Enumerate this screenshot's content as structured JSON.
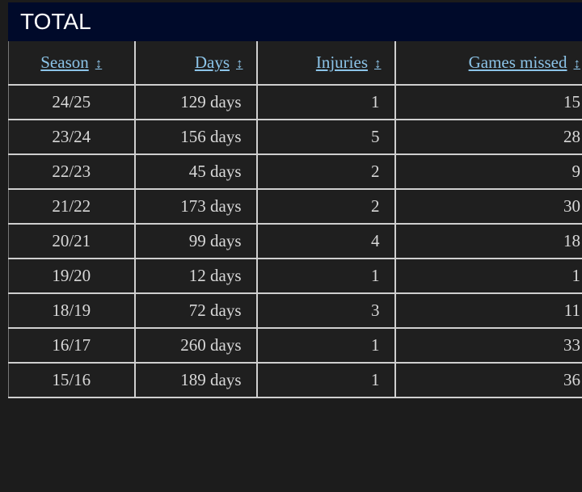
{
  "title": "TOTAL",
  "colors": {
    "header_bg": "#000a2a",
    "link": "#8cc4e8",
    "row_bg": "#1f1f1f"
  },
  "columns": [
    {
      "label": "Season",
      "sort_icon": "sort-arrows-icon"
    },
    {
      "label": "Days",
      "sort_icon": "sort-arrows-icon"
    },
    {
      "label": "Injuries",
      "sort_icon": "sort-arrows-icon"
    },
    {
      "label": "Games missed",
      "sort_icon": "sort-arrows-icon"
    }
  ],
  "rows": [
    {
      "season": "24/25",
      "days": "129 days",
      "injuries": "1",
      "games_missed": "15"
    },
    {
      "season": "23/24",
      "days": "156 days",
      "injuries": "5",
      "games_missed": "28"
    },
    {
      "season": "22/23",
      "days": "45 days",
      "injuries": "2",
      "games_missed": "9"
    },
    {
      "season": "21/22",
      "days": "173 days",
      "injuries": "2",
      "games_missed": "30"
    },
    {
      "season": "20/21",
      "days": "99 days",
      "injuries": "4",
      "games_missed": "18"
    },
    {
      "season": "19/20",
      "days": "12 days",
      "injuries": "1",
      "games_missed": "1"
    },
    {
      "season": "18/19",
      "days": "72 days",
      "injuries": "3",
      "games_missed": "11"
    },
    {
      "season": "16/17",
      "days": "260 days",
      "injuries": "1",
      "games_missed": "33"
    },
    {
      "season": "15/16",
      "days": "189 days",
      "injuries": "1",
      "games_missed": "36"
    }
  ]
}
